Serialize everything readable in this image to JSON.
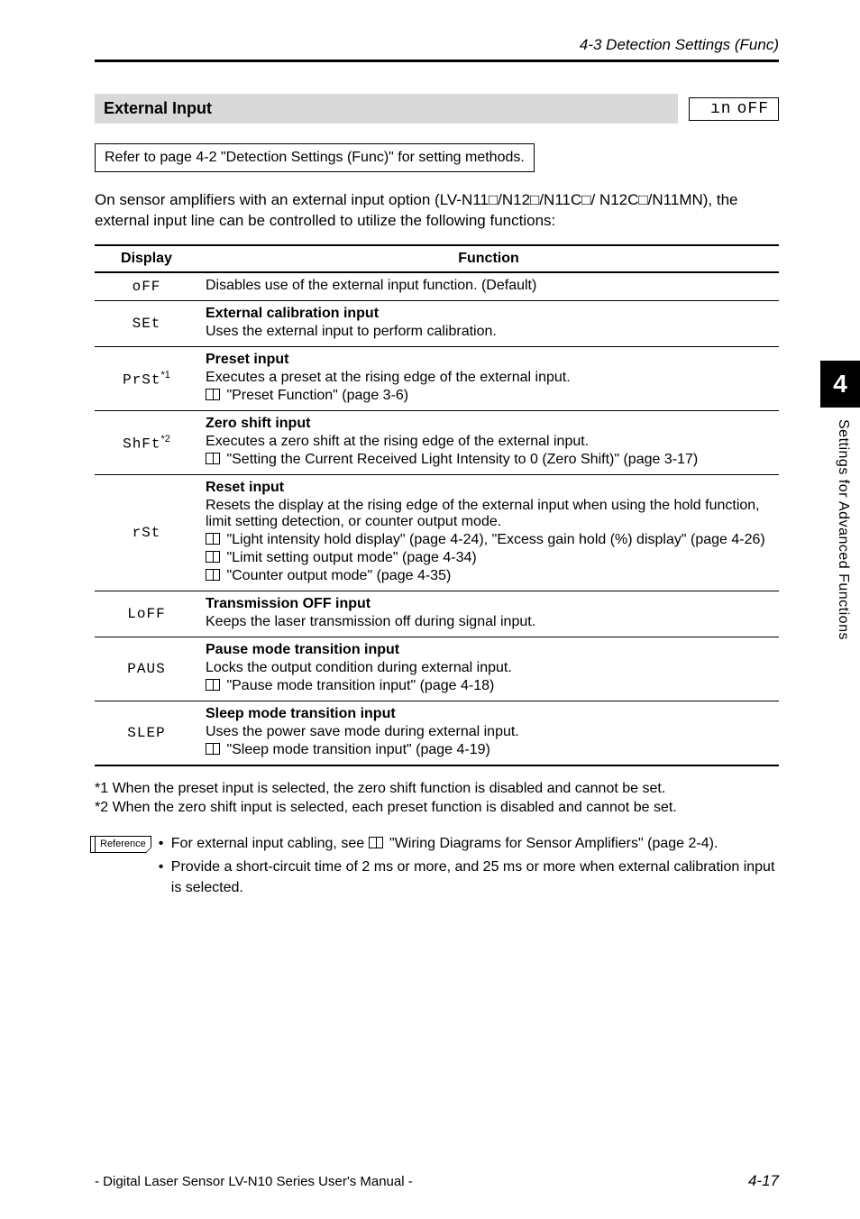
{
  "header": {
    "section_ref": "4-3 Detection Settings (Func)"
  },
  "section": {
    "title": "External Input",
    "lcd_left": "ın",
    "lcd_right": "oFF"
  },
  "refer_box": "Refer to page 4-2 \"Detection Settings (Func)\" for setting methods.",
  "intro": "On sensor amplifiers with an external input option (LV-N11□/N12□/N11C□/ N12C□/N11MN), the external input line can be controlled to utilize the following functions:",
  "table": {
    "headers": {
      "display": "Display",
      "function": "Function"
    },
    "rows": [
      {
        "display": "oFF",
        "func_lines": [
          {
            "text": "Disables use of the external input function. (Default)"
          }
        ]
      },
      {
        "display": "SEt",
        "func_lines": [
          {
            "bold": "External calibration input"
          },
          {
            "text": "Uses the external input to perform calibration."
          }
        ]
      },
      {
        "display": "PrSt",
        "sup": "*1",
        "func_lines": [
          {
            "bold": "Preset input"
          },
          {
            "text": "Executes a preset at the rising edge of the external input."
          },
          {
            "book": true,
            "text": "\"Preset Function\" (page 3-6)"
          }
        ]
      },
      {
        "display": "ShFt",
        "sup": "*2",
        "func_lines": [
          {
            "bold": "Zero shift input"
          },
          {
            "text": "Executes a zero shift at the rising edge of the external input."
          },
          {
            "book": true,
            "text": "\"Setting the Current Received Light Intensity to 0 (Zero Shift)\" (page 3-17)"
          }
        ]
      },
      {
        "display": "rSt",
        "func_lines": [
          {
            "bold": "Reset input"
          },
          {
            "text": "Resets the display at the rising edge of the external input when using the hold function, limit setting detection, or counter output mode."
          },
          {
            "book": true,
            "text": "\"Light intensity hold display\" (page 4-24), \"Excess gain hold (%) display\" (page 4-26)"
          },
          {
            "book": true,
            "text": "\"Limit setting output mode\" (page 4-34)"
          },
          {
            "book": true,
            "text": "\"Counter output mode\" (page 4-35)"
          }
        ]
      },
      {
        "display": "LoFF",
        "func_lines": [
          {
            "bold": "Transmission OFF input"
          },
          {
            "text": "Keeps the laser transmission off during signal input."
          }
        ]
      },
      {
        "display": "PAUS",
        "func_lines": [
          {
            "bold": "Pause mode transition input"
          },
          {
            "text": "Locks the output condition during external input."
          },
          {
            "book": true,
            "text": "\"Pause mode transition input\" (page 4-18)"
          }
        ]
      },
      {
        "display": "SLEP",
        "func_lines": [
          {
            "bold": "Sleep mode transition input"
          },
          {
            "text": "Uses the power save mode during external input."
          },
          {
            "book": true,
            "text": "\"Sleep mode transition input\" (page 4-19)"
          }
        ]
      }
    ]
  },
  "footnotes": {
    "f1": "*1 When the preset input is selected, the zero shift function is disabled and cannot be set.",
    "f2": "*2 When the zero shift input is selected, each preset function is disabled and cannot be set."
  },
  "reference": {
    "label": "Reference",
    "b1a": "For external input cabling, see ",
    "b1b": "\"Wiring Diagrams for Sensor Amplifiers\" (page 2-4).",
    "b2": "Provide a short-circuit time of 2 ms or more, and 25 ms or more when external calibration input is selected."
  },
  "sidebar": {
    "chapter": "4",
    "title": "Settings for Advanced Functions"
  },
  "footer": {
    "manual": "- Digital Laser Sensor LV-N10 Series User's Manual -",
    "page": "4-17"
  }
}
